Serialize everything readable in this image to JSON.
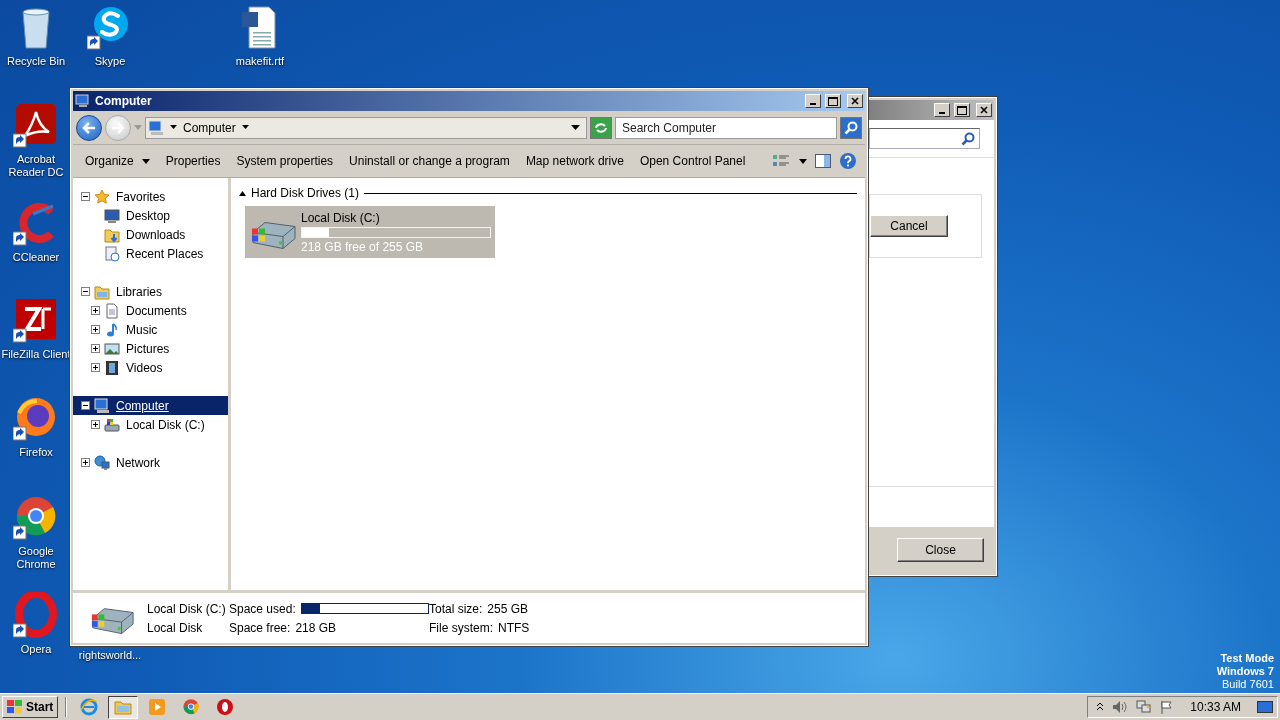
{
  "desktop_icons": [
    {
      "label": "Recycle Bin",
      "kind": "recycle",
      "shortcut": false
    },
    {
      "label": "Skype",
      "kind": "skype",
      "shortcut": true
    },
    {
      "label": "makefit.rtf",
      "kind": "document",
      "shortcut": false
    },
    {
      "label": "Acrobat Reader DC",
      "kind": "acrobat",
      "shortcut": true
    },
    {
      "label": "CCleaner",
      "kind": "ccleaner",
      "shortcut": true
    },
    {
      "label": "FileZilla Client",
      "kind": "filezilla",
      "shortcut": true
    },
    {
      "label": "Firefox",
      "kind": "firefox",
      "shortcut": true
    },
    {
      "label": "Google Chrome",
      "kind": "chrome",
      "shortcut": true
    },
    {
      "label": "Opera",
      "kind": "opera",
      "shortcut": true
    },
    {
      "label": "rightsworld..."
    }
  ],
  "desktop_notice": [
    {
      "text": "Test Mode",
      "bold": true
    },
    {
      "text": "Windows 7",
      "bold": true
    },
    {
      "text": "Build 7601",
      "bold": false
    }
  ],
  "back_window": {
    "buttons": [
      {
        "label": "Cancel",
        "kind": "group"
      },
      {
        "label": "Close",
        "kind": "footer"
      }
    ]
  },
  "explorer": {
    "title": "Computer",
    "address": "Computer",
    "search": {
      "placeholder": "Search Computer"
    },
    "toolbar": [
      {
        "label": "Organize",
        "menu": true
      },
      {
        "label": "Properties",
        "menu": false
      },
      {
        "label": "System properties",
        "menu": false
      },
      {
        "label": "Uninstall or change a program",
        "menu": false
      },
      {
        "label": "Map network drive",
        "menu": false
      },
      {
        "label": "Open Control Panel",
        "menu": false
      }
    ],
    "tree": [
      {
        "label": "Favorites",
        "kind": "star",
        "expanded": true,
        "selected": false,
        "children": [
          {
            "label": "Desktop",
            "kind": "monitor",
            "selected": false
          },
          {
            "label": "Downloads",
            "kind": "download",
            "selected": false
          },
          {
            "label": "Recent Places",
            "kind": "recent",
            "selected": false
          }
        ]
      },
      {
        "label": "Libraries",
        "kind": "library",
        "expanded": true,
        "selected": false,
        "children": [
          {
            "label": "Documents",
            "kind": "document",
            "expanded": false,
            "selected": false
          },
          {
            "label": "Music",
            "kind": "music",
            "expanded": false,
            "selected": false
          },
          {
            "label": "Pictures",
            "kind": "picture",
            "expanded": false,
            "selected": false
          },
          {
            "label": "Videos",
            "kind": "video",
            "expanded": false,
            "selected": false
          }
        ]
      },
      {
        "label": "Computer",
        "kind": "computer",
        "expanded": true,
        "selected": true,
        "children": [
          {
            "label": "Local Disk (C:)",
            "kind": "drive",
            "expanded": false,
            "selected": false
          }
        ]
      },
      {
        "label": "Network",
        "kind": "network",
        "expanded": false,
        "selected": false
      }
    ],
    "group": {
      "title": "Hard Disk Drives (1)",
      "expanded": true
    },
    "drives": [
      {
        "name": "Local Disk (C:)",
        "level": 0.145,
        "free": "218 GB free of 255 GB",
        "selected": true
      }
    ],
    "details": {
      "name": "Local Disk (C:)",
      "type": "Local Disk",
      "fields": [
        {
          "label": "Space used:",
          "kind": "bar",
          "level": 0.145
        },
        {
          "label": "Total size:",
          "kind": "text",
          "value": "255 GB"
        },
        {
          "label": "Space free:",
          "kind": "text",
          "value": "218 GB"
        },
        {
          "label": "File system:",
          "kind": "text",
          "value": "NTFS"
        }
      ]
    }
  },
  "taskbar": {
    "start": "Start",
    "apps": [
      {
        "kind": "ie",
        "selected": false
      },
      {
        "kind": "explorer",
        "selected": true
      },
      {
        "kind": "media",
        "selected": false
      },
      {
        "kind": "chrome",
        "selected": false
      },
      {
        "kind": "opera",
        "selected": false
      }
    ],
    "clock": "10:33 AM"
  }
}
